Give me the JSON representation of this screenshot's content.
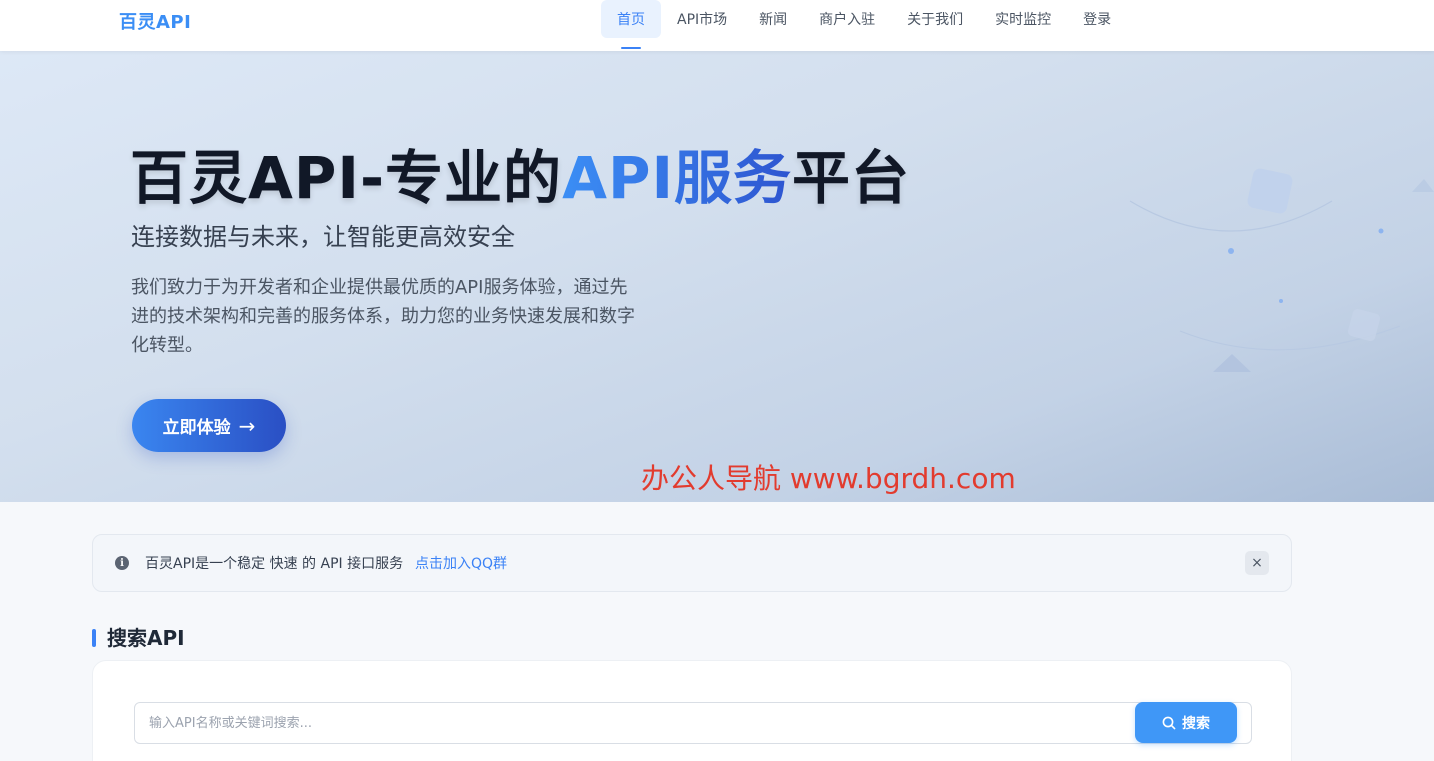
{
  "header": {
    "brand": "百灵API",
    "nav": [
      {
        "label": "首页",
        "active": true
      },
      {
        "label": "API市场",
        "active": false
      },
      {
        "label": "新闻",
        "active": false
      },
      {
        "label": "商户入驻",
        "active": false
      },
      {
        "label": "关于我们",
        "active": false
      },
      {
        "label": "实时监控",
        "active": false
      },
      {
        "label": "登录",
        "active": false
      }
    ]
  },
  "hero": {
    "title_prefix": "百灵API-专业的",
    "title_accent": "API服务",
    "title_suffix": "平台",
    "subtitle": "连接数据与未来，让智能更高效安全",
    "description": "我们致力于为开发者和企业提供最优质的API服务体验，通过先进的技术架构和完善的服务体系，助力您的业务快速发展和数字化转型。",
    "cta_label": "立即体验",
    "cta_arrow": "→"
  },
  "watermark": "办公人导航 www.bgrdh.com",
  "notice": {
    "icon": "info-icon",
    "text": "百灵API是一个稳定 快速 的 API 接口服务",
    "link": "点击加入QQ群",
    "close": "×"
  },
  "search": {
    "section_title": "搜索API",
    "placeholder": "输入API名称或关键词搜索...",
    "button_label": "搜索"
  },
  "colors": {
    "accent": "#3b82f6",
    "cta_start": "#3a86f0",
    "cta_end": "#2a4fc4",
    "watermark": "#e23b2e"
  }
}
